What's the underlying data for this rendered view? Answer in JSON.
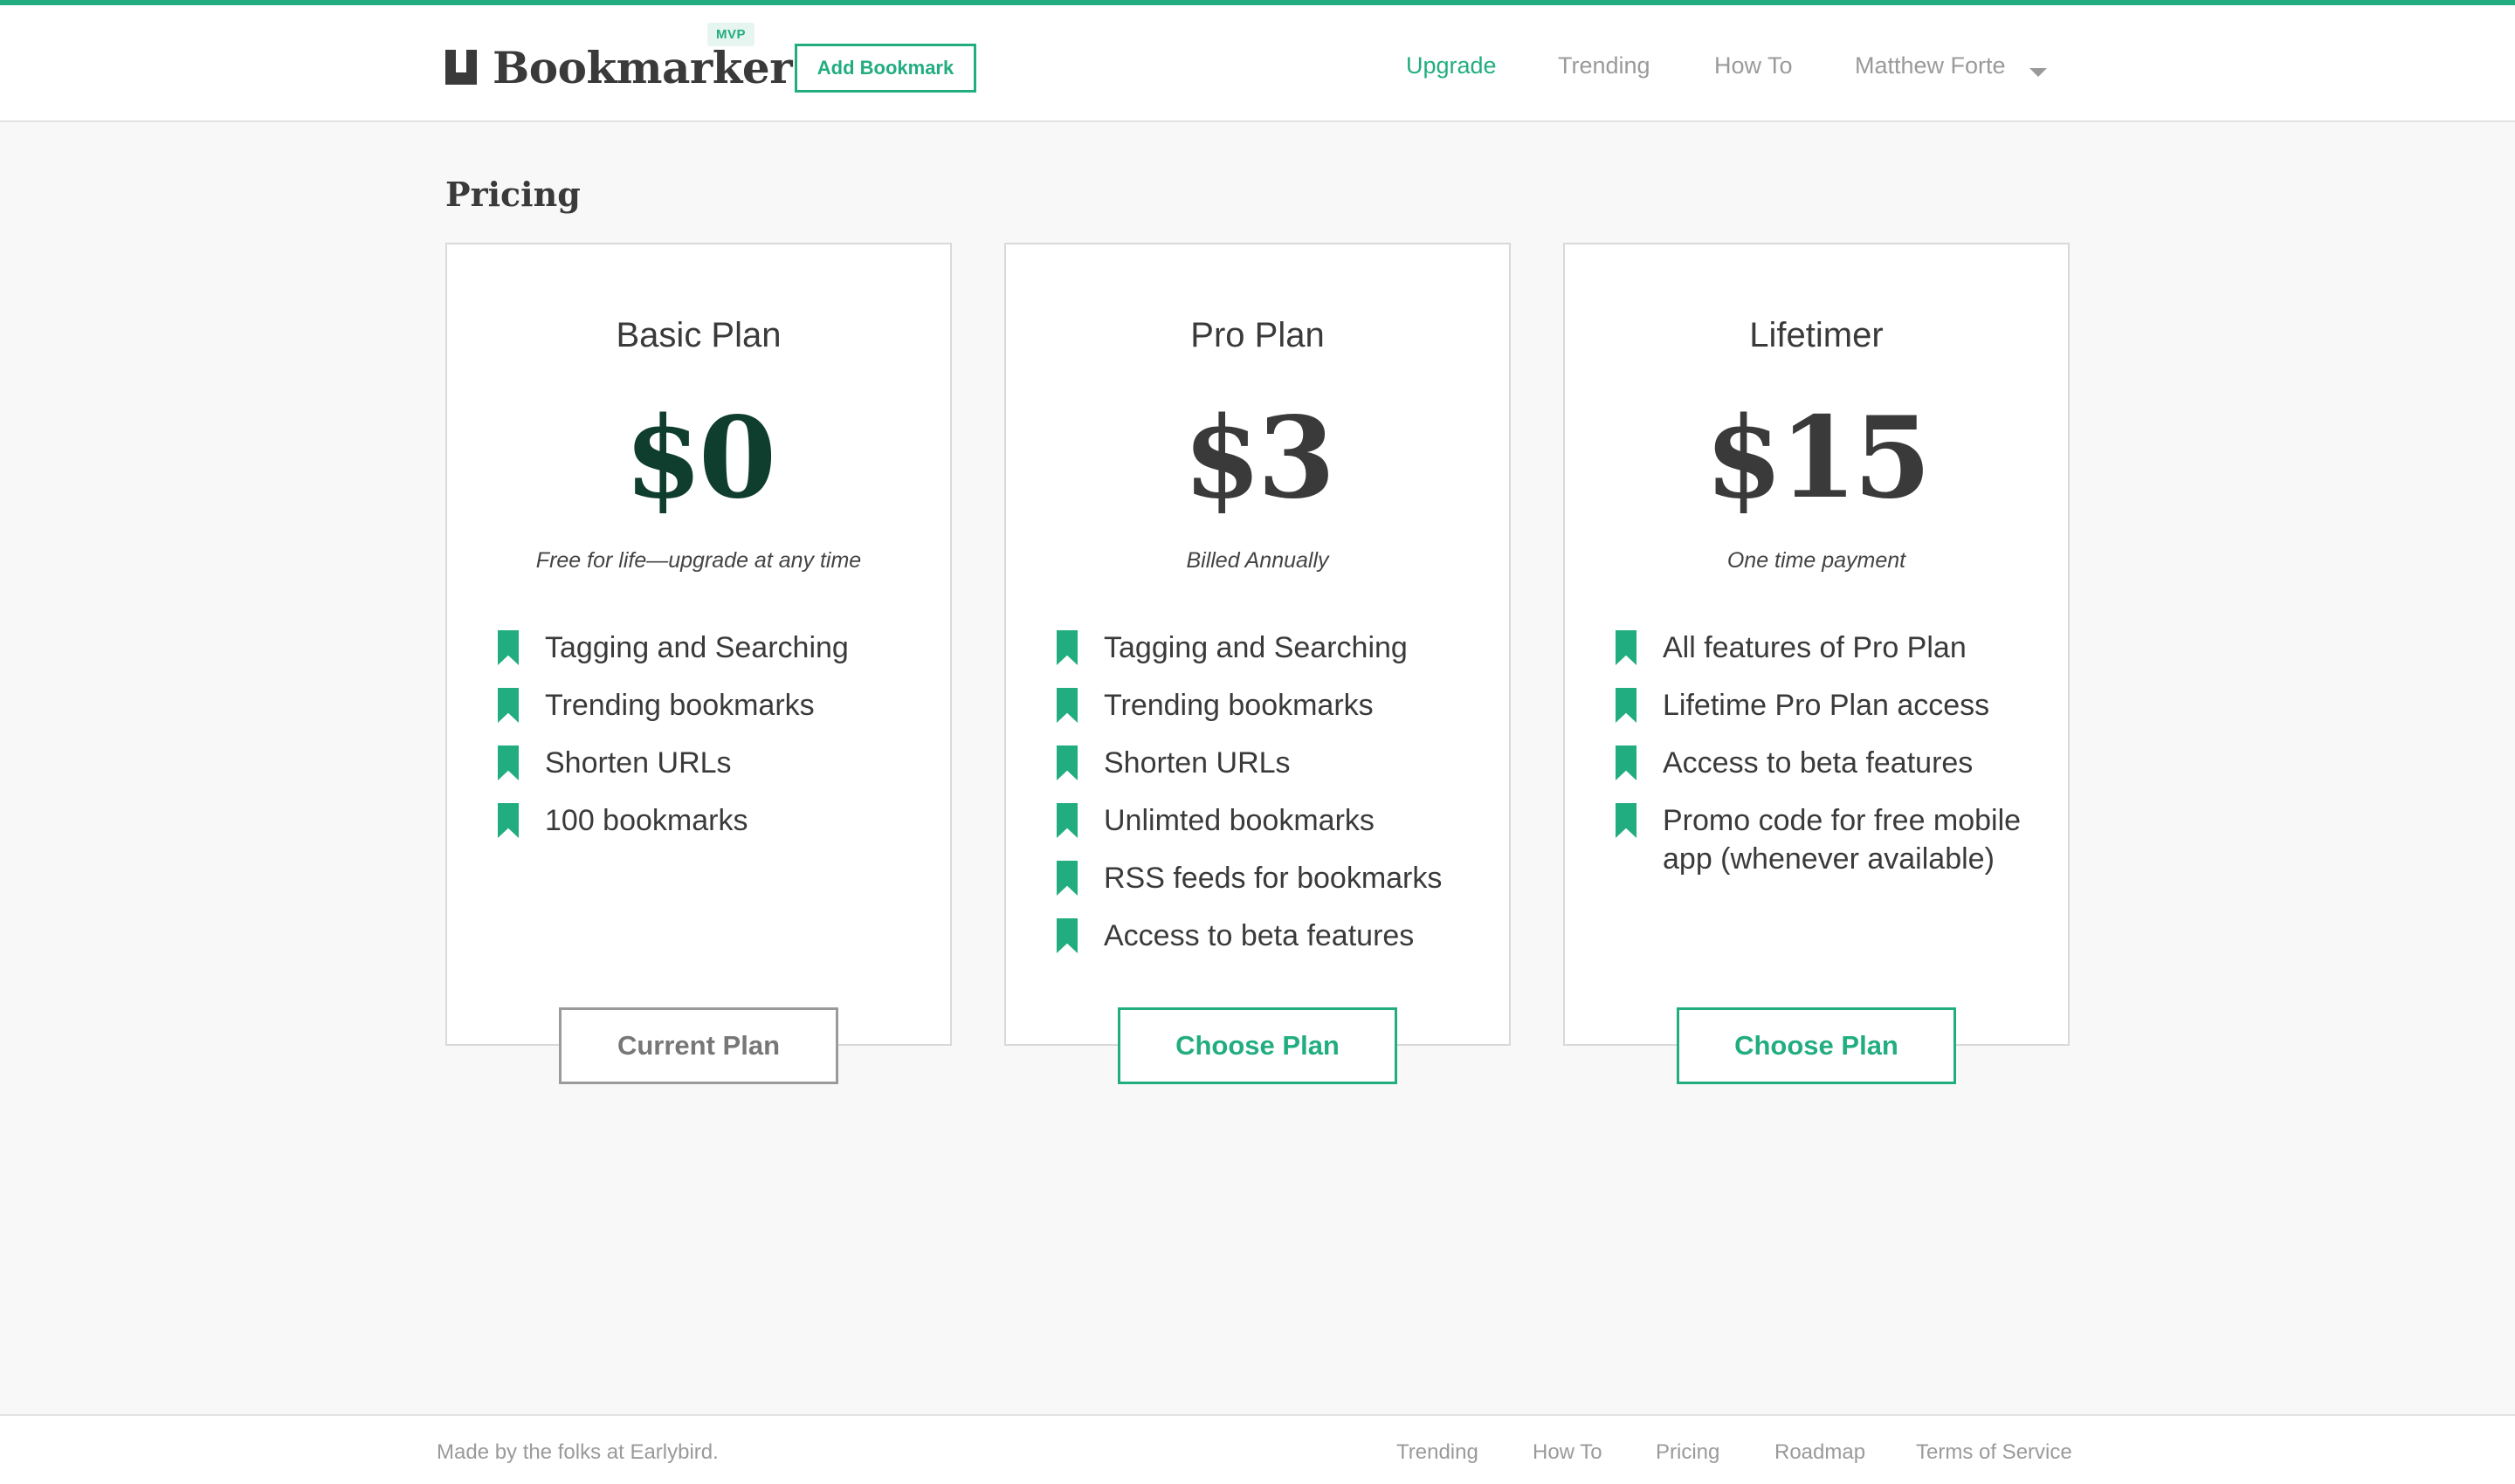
{
  "brand": {
    "name": "Bookmarker",
    "badge": "MVP",
    "accent_color": "#22ad80",
    "logo_icon": "bookmark-logo-icon"
  },
  "header": {
    "add_button": "Add Bookmark",
    "nav": [
      "Upgrade",
      "Trending",
      "How To"
    ],
    "active_nav": "Upgrade",
    "user_name": "Matthew Forte",
    "user_menu_icon": "caret-down-icon"
  },
  "page": {
    "title": "Pricing"
  },
  "plans": [
    {
      "name": "Basic Plan",
      "price": "$0",
      "note": "Free for life—upgrade at any time",
      "features": [
        "Tagging and Searching",
        "Trending bookmarks",
        "Shorten URLs",
        "100 bookmarks"
      ],
      "button": "Current Plan"
    },
    {
      "name": "Pro Plan",
      "price": "$3",
      "note": "Billed Annually",
      "features": [
        "Tagging and Searching",
        "Trending bookmarks",
        "Shorten URLs",
        "Unlimted bookmarks",
        "RSS feeds for bookmarks",
        "Access to beta features"
      ],
      "button": "Choose Plan"
    },
    {
      "name": "Lifetimer",
      "price": "$15",
      "note": "One time payment",
      "features": [
        "All features of Pro Plan",
        "Lifetime Pro Plan access",
        "Access to beta features",
        "Promo code for free mobile app (whenever available)"
      ],
      "button": "Choose Plan"
    }
  ],
  "feature_icon": "bookmark-ribbon-icon",
  "footer": {
    "credit": "Made by the folks at Earlybird.",
    "links": [
      "Trending",
      "How To",
      "Pricing",
      "Roadmap",
      "Terms of Service"
    ]
  }
}
